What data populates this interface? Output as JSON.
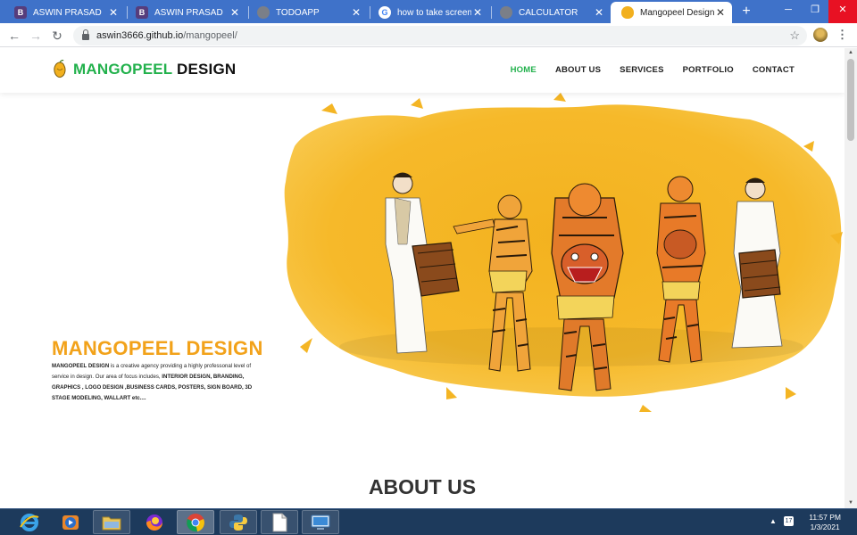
{
  "browser": {
    "tabs": [
      {
        "title": "ASWIN PRASAD",
        "favicon": "bootstrap-icon",
        "active": false
      },
      {
        "title": "ASWIN PRASAD",
        "favicon": "bootstrap-icon",
        "active": false
      },
      {
        "title": "TODOAPP",
        "favicon": "globe-icon",
        "active": false
      },
      {
        "title": "how to take screensh",
        "favicon": "google-icon",
        "active": false
      },
      {
        "title": "CALCULATOR",
        "favicon": "globe-icon",
        "active": false
      },
      {
        "title": "Mangopeel Design",
        "favicon": "mango-icon",
        "active": true
      }
    ],
    "url_host": "aswin3666.github.io",
    "url_path": "/mangopeel/"
  },
  "site": {
    "brand_green": "MANGOPEEL",
    "brand_dark": "DESIGN",
    "nav": [
      "HOME",
      "ABOUT US",
      "SERVICES",
      "PORTFOLIO",
      "CONTACT"
    ],
    "nav_active": "HOME",
    "hero_title": "MANGOPEEL DESIGN",
    "hero_desc": {
      "p1": "MANGOPEEL DESIGN",
      "p2": " is a creative agency providing a highly professonal level of service in design. Our area of focus includes, ",
      "p3": "INTERIOR DESIGN, BRANDING, GRAPHICS , LOGO DESIGN ,BUSINESS CARDS, POSTERS, SIGN BOARD, 3D STAGE MODELING, WALLART etc...."
    },
    "about_title": "ABOUT US"
  },
  "taskbar": {
    "apps": [
      "internet-explorer-icon",
      "media-player-icon",
      "file-explorer-icon",
      "firefox-icon",
      "chrome-icon",
      "python-icon",
      "notepad-icon",
      "remote-desktop-icon"
    ],
    "time": "11:57 PM",
    "date": "1/3/2021"
  },
  "colors": {
    "accent_green": "#22b14c",
    "hero_orange": "#f2a21a",
    "tab_strip": "#3f72c9",
    "taskbar": "#1d3a5c"
  }
}
